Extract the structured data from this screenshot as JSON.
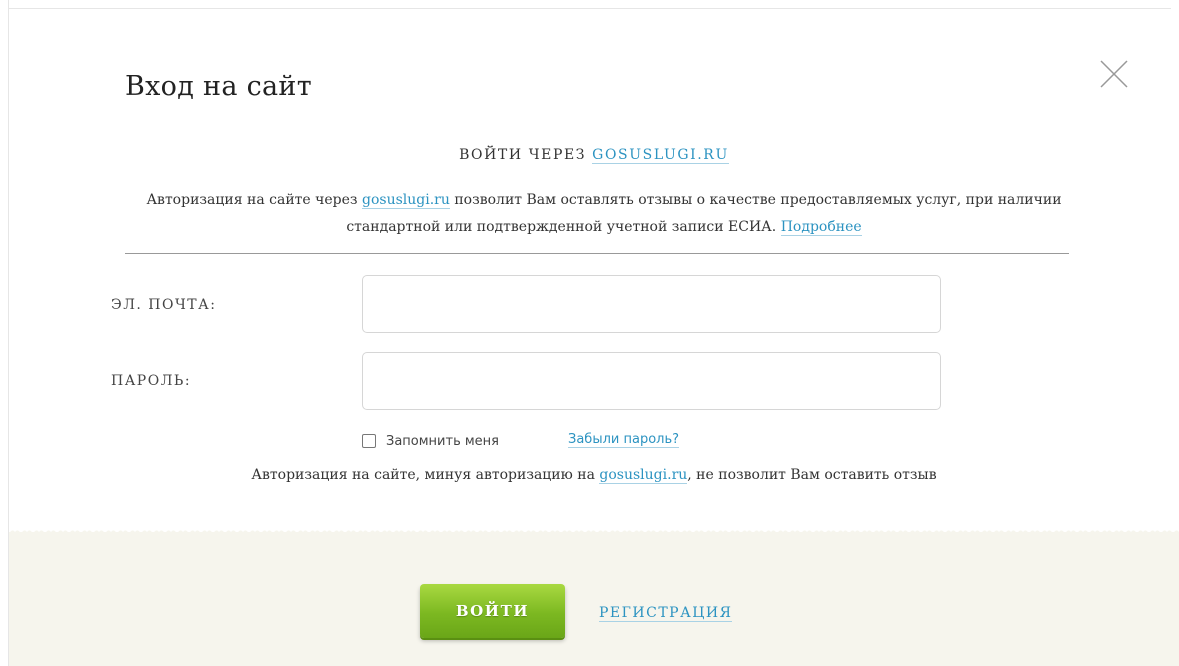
{
  "modal": {
    "title": "Вход на сайт"
  },
  "gosuslugi": {
    "header_prefix": "ВОЙТИ ЧЕРЕЗ",
    "header_link": "GOSUSLUGI.RU",
    "desc_before": "Авторизация на сайте через",
    "desc_link": "gosuslugi.ru",
    "desc_middle": "позволит Вам оставлять отзывы о качестве предоставляемых услуг, при наличии стандартной или подтвержденной учетной записи ЕСИА.",
    "more_link": "Подробнее"
  },
  "form": {
    "email_label": "ЭЛ. ПОЧТА:",
    "email_value": "",
    "password_label": "ПАРОЛЬ:",
    "password_value": "",
    "remember_label": "Запомнить меня",
    "remember_checked": false,
    "forgot_link": "Забыли пароль?"
  },
  "note": {
    "before": "Авторизация на сайте, минуя авторизацию на",
    "link": "gosuslugi.ru",
    "after": ", не позволит Вам оставить отзыв"
  },
  "footer": {
    "login_button": "ВОЙТИ",
    "register_link": "РЕГИСТРАЦИЯ"
  },
  "colors": {
    "link": "#2c93c1",
    "button_green": "#7cb821",
    "footer_bg": "#f6f5ed"
  }
}
